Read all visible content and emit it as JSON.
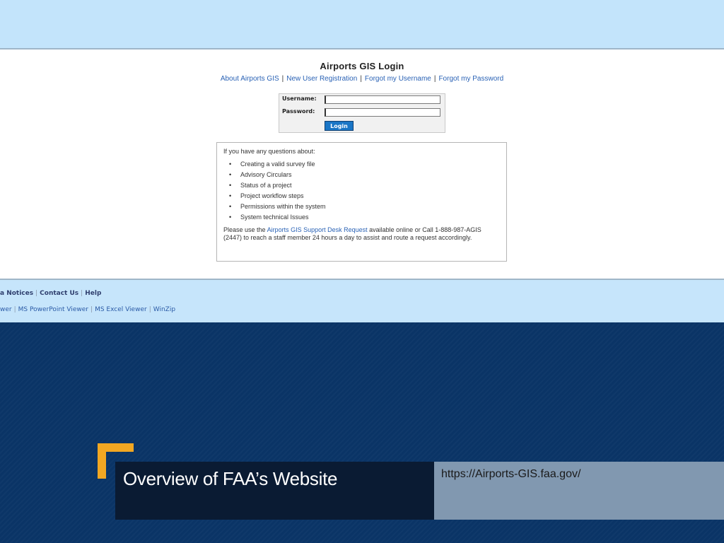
{
  "login_page": {
    "title": "Airports GIS Login",
    "nav_links": [
      "About Airports GIS",
      "New User Registration",
      "Forgot my Username",
      "Forgot my Password"
    ],
    "separator": "|",
    "username_label": "Username:",
    "password_label": "Password:",
    "username_value": "",
    "password_value": "",
    "login_button": "Login",
    "info": {
      "intro": "If you have any questions about:",
      "items": [
        "Creating a valid survey file",
        "Advisory Circulars",
        "Status of a project",
        "Project workflow steps",
        "Permissions within the system",
        "System technical Issues"
      ],
      "closing_prefix": "Please use the",
      "closing_link": "Airports GIS Support Desk Request",
      "closing_suffix": "available online or Call 1-888-987-AGIS (2447) to reach a staff member 24 hours a day to assist and route a request accordingly."
    }
  },
  "footer": {
    "row1": [
      "a Notices",
      "Contact Us",
      "Help"
    ],
    "row2": [
      "wer",
      "MS PowerPoint Viewer",
      "MS Excel Viewer",
      "WinZip"
    ],
    "separator": "|"
  },
  "slide": {
    "title": "Overview of FAA’s Website",
    "url": "https://Airports-GIS.faa.gov/"
  },
  "colors": {
    "slide_background": "#0a3466",
    "accent": "#f2a722",
    "title_panel": "#0a1b33",
    "url_panel": "#8198b0",
    "link": "#2a62b5",
    "login_button": "#1a76c6"
  }
}
